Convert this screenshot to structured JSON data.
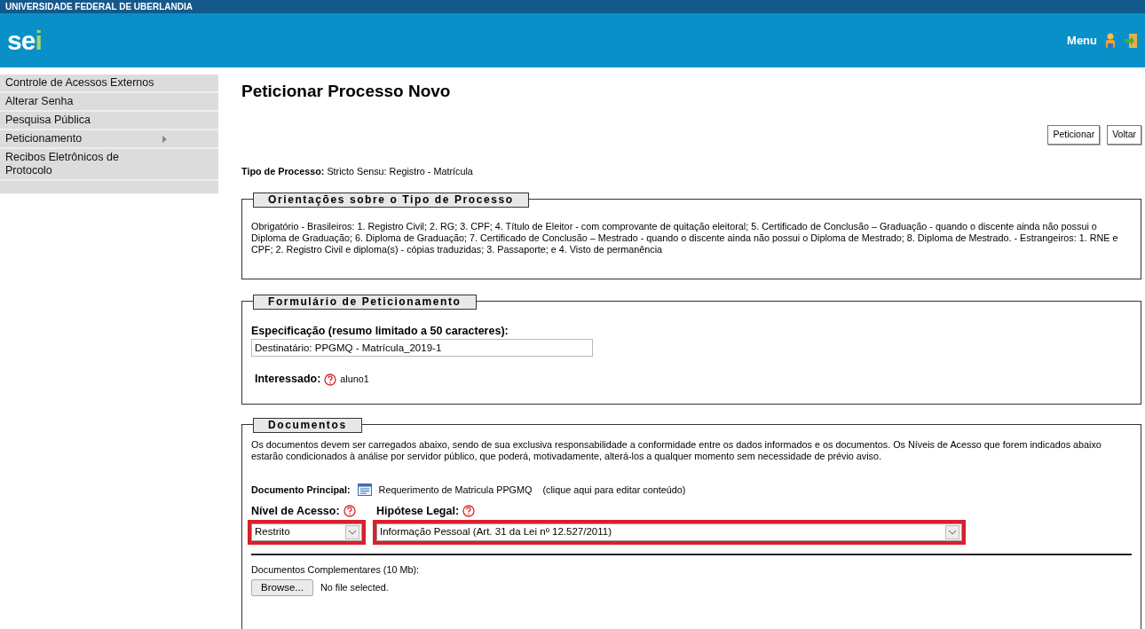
{
  "header": {
    "institution": "UNIVERSIDADE FEDERAL DE UBERLANDIA",
    "logo": "sei",
    "menu_label": "Menu"
  },
  "sidebar": {
    "items": [
      {
        "label": "Controle de Acessos Externos",
        "has_submenu": false
      },
      {
        "label": "Alterar Senha",
        "has_submenu": false
      },
      {
        "label": "Pesquisa Pública",
        "has_submenu": false
      },
      {
        "label": "Peticionamento",
        "has_submenu": true
      },
      {
        "label": "Recibos Eletrônicos de Protocolo",
        "has_submenu": false
      }
    ]
  },
  "page": {
    "title": "Peticionar Processo Novo",
    "buttons": [
      "Peticionar",
      "Voltar"
    ],
    "tipo_label": "Tipo de Processo:",
    "tipo_value": "Stricto Sensu: Registro - Matrícula"
  },
  "orientacoes": {
    "legend": "Orientações sobre o Tipo de Processo",
    "text": "Obrigatório - Brasileiros: 1. Registro Civil; 2. RG; 3. CPF; 4. Título de Eleitor - com comprovante de quitação eleitoral; 5. Certificado de Conclusão – Graduação - quando o discente ainda não possui o Diploma de Graduação; 6. Diploma de Graduação; 7. Certificado de Conclusão – Mestrado - quando o discente ainda não possui o Diploma de Mestrado; 8. Diploma de Mestrado. - Estrangeiros: 1. RNE e CPF; 2. Registro Civil e diploma(s) - cópias traduzidas; 3. Passaporte; e 4. Visto de permanência"
  },
  "formulario": {
    "legend": "Formulário de Peticionamento",
    "spec_label": "Especificação (resumo limitado a 50 caracteres):",
    "spec_value": "Destinatário: PPGMQ - Matrícula_2019-1",
    "interessado_label": "Interessado:",
    "interessado_value": "aluno1"
  },
  "documentos": {
    "legend": "Documentos",
    "text": "Os documentos devem ser carregados abaixo, sendo de sua exclusiva responsabilidade a conformidade entre os dados informados e os documentos. Os Níveis de Acesso que forem indicados abaixo estarão condicionados à análise por servidor público, que poderá, motivadamente, alterá-los a qualquer momento sem necessidade de prévio aviso.",
    "principal_label": "Documento Principal:",
    "principal_name": "Requerimento de Matricula PPGMQ",
    "principal_hint": "(clique aqui para editar conteúdo)",
    "selects": [
      {
        "label": "Nível de Acesso:",
        "value": "Restrito",
        "highlighted": true
      },
      {
        "label": "Hipótese Legal:",
        "value": "Informação Pessoal (Art. 31 da Lei nº 12.527/2011)",
        "highlighted": true
      }
    ],
    "complementares_label": "Documentos Complementares (10 Mb):",
    "browse_button": "Browse...",
    "file_status": "No file selected."
  }
}
